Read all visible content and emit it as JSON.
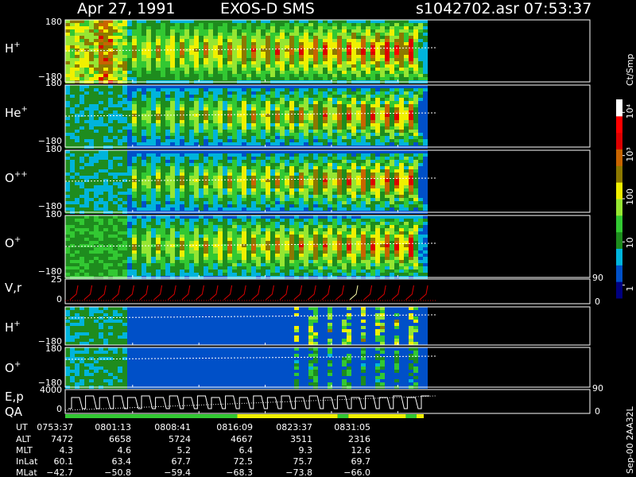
{
  "header": {
    "date": "Apr 27, 1991",
    "instrument": "EXOS-D SMS",
    "file": "s1042702.asr",
    "time": "07:53:37"
  },
  "panels": [
    {
      "label": "H",
      "sup": "+",
      "ytop": "180",
      "ybottom": "−180"
    },
    {
      "label": "He",
      "sup": "+",
      "ytop": "180",
      "ybottom": "−180"
    },
    {
      "label": "O",
      "sup": "++",
      "ytop": "180",
      "ybottom": "−180"
    },
    {
      "label": "O",
      "sup": "+",
      "ytop": "180",
      "ybottom": "−180"
    },
    {
      "label": "H",
      "sup": "+",
      "ytop": "",
      "ybottom": "−180"
    },
    {
      "label": "O",
      "sup": "+",
      "ytop": "180",
      "ybottom": "−180"
    }
  ],
  "line_panels": [
    {
      "label": "V,r",
      "ytop": "25",
      "yzero": "0",
      "rtop": "90",
      "rzero": "0"
    },
    {
      "label": "E,p",
      "ytop": "4000",
      "yzero": "0",
      "rtop": "90",
      "rzero": "0"
    }
  ],
  "qa": {
    "label": "QA",
    "segments": [
      {
        "from": 0.0,
        "to": 0.48,
        "color": "#32c832"
      },
      {
        "from": 0.48,
        "to": 0.76,
        "color": "#f0f000"
      },
      {
        "from": 0.76,
        "to": 0.79,
        "color": "#32c832"
      },
      {
        "from": 0.79,
        "to": 0.95,
        "color": "#f0f000"
      },
      {
        "from": 0.95,
        "to": 0.98,
        "color": "#32c832"
      },
      {
        "from": 0.98,
        "to": 1.0,
        "color": "#f0f000"
      }
    ]
  },
  "ephemeris": {
    "labels": [
      "UT",
      "ALT",
      "MLT",
      "InLat",
      "MLat"
    ],
    "columns": [
      {
        "ut": "0753:37",
        "alt": "7472",
        "mlt": "4.3",
        "invlat": "60.1",
        "mlat": "−42.7"
      },
      {
        "ut": "0801:13",
        "alt": "6658",
        "mlt": "4.6",
        "invlat": "63.4",
        "mlat": "−50.8"
      },
      {
        "ut": "0808:41",
        "alt": "5724",
        "mlt": "5.2",
        "invlat": "67.7",
        "mlat": "−59.4"
      },
      {
        "ut": "0816:09",
        "alt": "4667",
        "mlt": "6.4",
        "invlat": "72.5",
        "mlat": "−68.3"
      },
      {
        "ut": "0823:37",
        "alt": "3511",
        "mlt": "9.3",
        "invlat": "75.7",
        "mlat": "−73.8"
      },
      {
        "ut": "0831:05",
        "alt": "2316",
        "mlt": "12.6",
        "invlat": "69.7",
        "mlat": "−66.0"
      }
    ]
  },
  "colorbar": {
    "unit": "Ct/Smp",
    "ticks": [
      "10⁴",
      "10³",
      "100",
      "10",
      "1"
    ],
    "tick_values": [
      10000,
      1000,
      100,
      10,
      1
    ],
    "range": [
      0.5,
      20000
    ],
    "colors": [
      "#000080",
      "#0050c8",
      "#00b4dc",
      "#1e8c1e",
      "#32c832",
      "#96e632",
      "#f0f000",
      "#8c7800",
      "#c86400",
      "#dc0000",
      "#ff0000",
      "#ffffff"
    ]
  },
  "footer": {
    "version": "Sep-00 2AA32L"
  },
  "chart_data": {
    "type": "heatmap",
    "title": "Apr 27, 1991 EXOS-D SMS",
    "x_ticks": [
      "0753:37",
      "0801:13",
      "0808:41",
      "0816:09",
      "0823:37",
      "0831:05"
    ],
    "x_tick_fractions": [
      0.0,
      0.1685,
      0.3342,
      0.4999,
      0.6655,
      0.8312
    ],
    "data_end_fraction": 0.99,
    "spin_count": 24,
    "series": [
      {
        "name": "H+",
        "ylim": [
          -180,
          180
        ],
        "background_level": 2.0,
        "peak_level": 10.5
      },
      {
        "name": "He+",
        "ylim": [
          -180,
          180
        ],
        "background_level": 0.6,
        "peak_level": 10.0
      },
      {
        "name": "O++",
        "ylim": [
          -180,
          180
        ],
        "background_level": 0.6,
        "peak_level": 10.0
      },
      {
        "name": "O+",
        "ylim": [
          -180,
          180
        ],
        "background_level": 1.2,
        "peak_level": 10.0
      },
      {
        "name": "H+ (lower)",
        "ylim": [
          -180,
          180
        ],
        "background_level": 0.7,
        "peak_level": 6.0
      },
      {
        "name": "O+ (lower)",
        "ylim": [
          -180,
          180
        ],
        "background_level": 0.7,
        "peak_level": 4.0
      }
    ],
    "line_series": [
      {
        "name": "V,r",
        "ylim": [
          0,
          25
        ]
      },
      {
        "name": "E,p",
        "ylim": [
          0,
          4000
        ]
      }
    ]
  }
}
